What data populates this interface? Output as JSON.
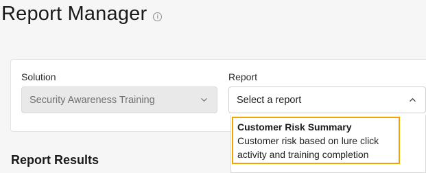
{
  "header": {
    "title": "Report Manager",
    "info_icon": "info-icon"
  },
  "filters": {
    "solution": {
      "label": "Solution",
      "value": "Security Awareness Training",
      "disabled": true,
      "icon": "chevron-down-icon"
    },
    "report": {
      "label": "Report",
      "placeholder": "Select a report",
      "expanded": true,
      "icon": "chevron-up-icon",
      "options": [
        {
          "title": "Customer Risk Summary",
          "description": "Customer risk based on lure click activity and training completion",
          "highlighted": true
        }
      ]
    }
  },
  "results": {
    "title": "Report Results"
  },
  "colors": {
    "background": "#f6f6f6",
    "card": "#ffffff",
    "highlight_border": "#f0a500",
    "disabled_field": "#e9e9e9"
  }
}
